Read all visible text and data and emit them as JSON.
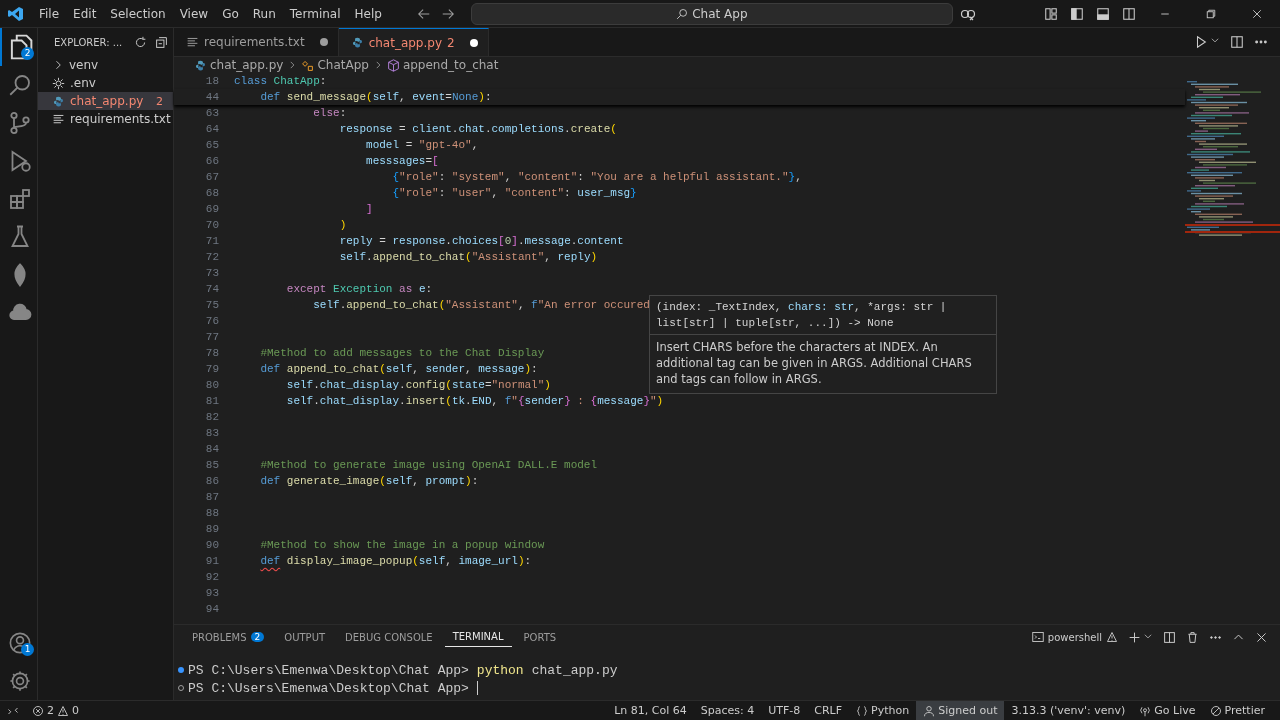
{
  "title_bar": {
    "menu": [
      "File",
      "Edit",
      "Selection",
      "View",
      "Go",
      "Run",
      "Terminal",
      "Help"
    ],
    "command_center": "Chat App"
  },
  "activity_bar": {
    "items": [
      {
        "kind": "files",
        "selected": true,
        "badge": "2"
      },
      {
        "kind": "search",
        "selected": false
      },
      {
        "kind": "branch",
        "selected": false
      },
      {
        "kind": "run",
        "selected": false
      },
      {
        "kind": "extensions",
        "selected": false
      },
      {
        "kind": "flask",
        "selected": false
      },
      {
        "kind": "leaf",
        "selected": false
      },
      {
        "kind": "cloud",
        "selected": false
      }
    ],
    "account_badge": "1"
  },
  "sidebar": {
    "title": "EXPLORER: ...",
    "items": [
      {
        "label": "venv",
        "kind": "folder",
        "expanded": false,
        "selected": false
      },
      {
        "label": ".env",
        "kind": "config",
        "selected": false
      },
      {
        "label": "chat_app.py",
        "kind": "python",
        "selected": true,
        "badge": "2"
      },
      {
        "label": "requirements.txt",
        "kind": "text",
        "selected": false
      }
    ]
  },
  "tabs": [
    {
      "label": "requirements.txt",
      "kind": "text",
      "selected": false,
      "modified": true
    },
    {
      "label": "chat_app.py",
      "kind": "python",
      "selected": true,
      "modified": true,
      "badge": "2"
    }
  ],
  "breadcrumbs": [
    {
      "label": "chat_app.py",
      "kind": "python"
    },
    {
      "label": "ChatApp",
      "kind": "class"
    },
    {
      "label": "append_to_chat",
      "kind": "method"
    }
  ],
  "editor": {
    "sticky_lines": [
      {
        "number": "18",
        "tokens": [
          {
            "text": "class ",
            "kind": "kwb"
          },
          {
            "text": "ChatApp",
            "kind": "cls"
          },
          {
            "text": ":",
            "kind": "p"
          }
        ]
      },
      {
        "number": "44",
        "tokens": [
          {
            "text": "    def ",
            "kind": "kwb"
          },
          {
            "text": "send_message",
            "kind": "fn"
          },
          {
            "text": "(",
            "kind": "b1"
          },
          {
            "text": "self",
            "kind": "var"
          },
          {
            "text": ", ",
            "kind": "p"
          },
          {
            "text": "event",
            "kind": "var"
          },
          {
            "text": "=",
            "kind": "p"
          },
          {
            "text": "None",
            "kind": "kwb"
          },
          {
            "text": ")",
            "kind": "b1"
          },
          {
            "text": ":",
            "kind": "p"
          }
        ]
      }
    ],
    "lines": [
      {
        "number": "63",
        "tokens": [
          {
            "text": "            else",
            "kind": "kw"
          },
          {
            "text": ":",
            "kind": "p"
          }
        ]
      },
      {
        "number": "64",
        "tokens": [
          {
            "text": "                response",
            "kind": "var"
          },
          {
            "text": " = ",
            "kind": "p"
          },
          {
            "text": "client",
            "kind": "var"
          },
          {
            "text": ".",
            "kind": "p"
          },
          {
            "text": "chat",
            "kind": "var"
          },
          {
            "text": ".",
            "kind": "p"
          },
          {
            "text": "completions",
            "kind": "var"
          },
          {
            "text": ".",
            "kind": "p"
          },
          {
            "text": "create",
            "kind": "fn"
          },
          {
            "text": "(",
            "kind": "b1"
          }
        ]
      },
      {
        "number": "65",
        "tokens": [
          {
            "text": "                    model",
            "kind": "var"
          },
          {
            "text": " = ",
            "kind": "p"
          },
          {
            "text": "\"gpt-4o\"",
            "kind": "str"
          },
          {
            "text": ",",
            "kind": "p"
          }
        ]
      },
      {
        "number": "66",
        "tokens": [
          {
            "text": "                    messsages",
            "kind": "var"
          },
          {
            "text": "=",
            "kind": "p"
          },
          {
            "text": "[",
            "kind": "b2"
          }
        ]
      },
      {
        "number": "67",
        "tokens": [
          {
            "text": "                        {",
            "kind": "b3"
          },
          {
            "text": "\"role\"",
            "kind": "str"
          },
          {
            "text": ": ",
            "kind": "p"
          },
          {
            "text": "\"system\"",
            "kind": "str"
          },
          {
            "text": ", ",
            "kind": "p"
          },
          {
            "text": "\"content\"",
            "kind": "str"
          },
          {
            "text": ": ",
            "kind": "p"
          },
          {
            "text": "\"You are a helpful assistant.\"",
            "kind": "str"
          },
          {
            "text": "}",
            "kind": "b3"
          },
          {
            "text": ",",
            "kind": "p"
          }
        ]
      },
      {
        "number": "68",
        "tokens": [
          {
            "text": "                        {",
            "kind": "b3"
          },
          {
            "text": "\"role\"",
            "kind": "str"
          },
          {
            "text": ": ",
            "kind": "p"
          },
          {
            "text": "\"user\"",
            "kind": "str"
          },
          {
            "text": ", ",
            "kind": "p"
          },
          {
            "text": "\"content\"",
            "kind": "str"
          },
          {
            "text": ": ",
            "kind": "p"
          },
          {
            "text": "user_msg",
            "kind": "var"
          },
          {
            "text": "}",
            "kind": "b3"
          }
        ]
      },
      {
        "number": "69",
        "tokens": [
          {
            "text": "                    ]",
            "kind": "b2"
          }
        ]
      },
      {
        "number": "70",
        "tokens": [
          {
            "text": "                )",
            "kind": "b1"
          }
        ]
      },
      {
        "number": "71",
        "tokens": [
          {
            "text": "                reply",
            "kind": "var"
          },
          {
            "text": " = ",
            "kind": "p"
          },
          {
            "text": "response",
            "kind": "var"
          },
          {
            "text": ".",
            "kind": "p"
          },
          {
            "text": "choices",
            "kind": "var"
          },
          {
            "text": "[",
            "kind": "b2"
          },
          {
            "text": "0",
            "kind": "num"
          },
          {
            "text": "]",
            "kind": "b2"
          },
          {
            "text": ".",
            "kind": "p"
          },
          {
            "text": "message",
            "kind": "var"
          },
          {
            "text": ".",
            "kind": "p"
          },
          {
            "text": "content",
            "kind": "var"
          }
        ]
      },
      {
        "number": "72",
        "tokens": [
          {
            "text": "                self",
            "kind": "var"
          },
          {
            "text": ".",
            "kind": "p"
          },
          {
            "text": "append_to_chat",
            "kind": "fn"
          },
          {
            "text": "(",
            "kind": "b1"
          },
          {
            "text": "\"Assistant\"",
            "kind": "str"
          },
          {
            "text": ", ",
            "kind": "p"
          },
          {
            "text": "reply",
            "kind": "var"
          },
          {
            "text": ")",
            "kind": "b1"
          }
        ]
      },
      {
        "number": "73"
      },
      {
        "number": "74",
        "tokens": [
          {
            "text": "        except ",
            "kind": "kw"
          },
          {
            "text": "Exception",
            "kind": "cls"
          },
          {
            "text": " as ",
            "kind": "kw"
          },
          {
            "text": "e",
            "kind": "var"
          },
          {
            "text": ":",
            "kind": "p"
          }
        ]
      },
      {
        "number": "75",
        "tokens": [
          {
            "text": "            self",
            "kind": "var"
          },
          {
            "text": ".",
            "kind": "p"
          },
          {
            "text": "append_to_chat",
            "kind": "fn"
          },
          {
            "text": "(",
            "kind": "b1"
          },
          {
            "text": "\"Assistant\"",
            "kind": "str"
          },
          {
            "text": ", ",
            "kind": "p"
          },
          {
            "text": "f",
            "kind": "kwb"
          },
          {
            "text": "\"An error occured",
            "kind": "str"
          }
        ]
      },
      {
        "number": "76"
      },
      {
        "number": "77"
      },
      {
        "number": "78",
        "tokens": [
          {
            "text": "    #Method to add messages to the Chat Display",
            "kind": "cmt"
          }
        ]
      },
      {
        "number": "79",
        "tokens": [
          {
            "text": "    def ",
            "kind": "kwb"
          },
          {
            "text": "append_to_chat",
            "kind": "fn"
          },
          {
            "text": "(",
            "kind": "b1"
          },
          {
            "text": "self",
            "kind": "var"
          },
          {
            "text": ", ",
            "kind": "p"
          },
          {
            "text": "sender",
            "kind": "var"
          },
          {
            "text": ", ",
            "kind": "p"
          },
          {
            "text": "message",
            "kind": "var"
          },
          {
            "text": ")",
            "kind": "b1"
          },
          {
            "text": ":",
            "kind": "p"
          }
        ]
      },
      {
        "number": "80",
        "tokens": [
          {
            "text": "        self",
            "kind": "var"
          },
          {
            "text": ".",
            "kind": "p"
          },
          {
            "text": "chat_display",
            "kind": "var"
          },
          {
            "text": ".",
            "kind": "p"
          },
          {
            "text": "config",
            "kind": "fn"
          },
          {
            "text": "(",
            "kind": "b1"
          },
          {
            "text": "state",
            "kind": "var"
          },
          {
            "text": "=",
            "kind": "p"
          },
          {
            "text": "\"normal\"",
            "kind": "str"
          },
          {
            "text": ")",
            "kind": "b1"
          }
        ]
      },
      {
        "number": "81",
        "tokens": [
          {
            "text": "        self",
            "kind": "var"
          },
          {
            "text": ".",
            "kind": "p"
          },
          {
            "text": "chat_display",
            "kind": "var"
          },
          {
            "text": ".",
            "kind": "p"
          },
          {
            "text": "insert",
            "kind": "fn"
          },
          {
            "text": "(",
            "kind": "b1"
          },
          {
            "text": "tk",
            "kind": "var"
          },
          {
            "text": ".",
            "kind": "p"
          },
          {
            "text": "END",
            "kind": "var"
          },
          {
            "text": ", ",
            "kind": "p"
          },
          {
            "text": "f",
            "kind": "kwb"
          },
          {
            "text": "\"",
            "kind": "str"
          },
          {
            "text": "{",
            "kind": "b2"
          },
          {
            "text": "sender",
            "kind": "var"
          },
          {
            "text": "}",
            "kind": "b2"
          },
          {
            "text": " : ",
            "kind": "str"
          },
          {
            "text": "{",
            "kind": "b2"
          },
          {
            "text": "message",
            "kind": "var"
          },
          {
            "text": "}",
            "kind": "b2"
          },
          {
            "text": "\"",
            "kind": "str"
          },
          {
            "text": ")",
            "kind": "b1"
          }
        ]
      },
      {
        "number": "82"
      },
      {
        "number": "83"
      },
      {
        "number": "84"
      },
      {
        "number": "85",
        "tokens": [
          {
            "text": "    #Method to generate image using OpenAI DALL.E model",
            "kind": "cmt"
          }
        ]
      },
      {
        "number": "86",
        "tokens": [
          {
            "text": "    def ",
            "kind": "kwb"
          },
          {
            "text": "generate_image",
            "kind": "fn"
          },
          {
            "text": "(",
            "kind": "b1"
          },
          {
            "text": "self",
            "kind": "var"
          },
          {
            "text": ", ",
            "kind": "p"
          },
          {
            "text": "prompt",
            "kind": "var"
          },
          {
            "text": ")",
            "kind": "b1"
          },
          {
            "text": ":",
            "kind": "p"
          }
        ]
      },
      {
        "number": "87"
      },
      {
        "number": "88"
      },
      {
        "number": "89"
      },
      {
        "number": "90",
        "tokens": [
          {
            "text": "    #Method to show the image in a popup window",
            "kind": "cmt"
          }
        ]
      },
      {
        "number": "91",
        "tokens": [
          {
            "text": "    def",
            "kind": "err"
          },
          {
            "text": " display_image_popup",
            "kind": "fn"
          },
          {
            "text": "(",
            "kind": "b1"
          },
          {
            "text": "self",
            "kind": "var"
          },
          {
            "text": ", ",
            "kind": "p"
          },
          {
            "text": "image_url",
            "kind": "var"
          },
          {
            "text": ")",
            "kind": "b1"
          },
          {
            "text": ":",
            "kind": "p"
          }
        ]
      },
      {
        "number": "92"
      },
      {
        "number": "93"
      },
      {
        "number": "94"
      }
    ]
  },
  "hover": {
    "signature": [
      {
        "text": "(index: _TextIndex, ",
        "kind": "p"
      },
      {
        "text": "chars: str",
        "kind": "var"
      },
      {
        "text": ", *args: str | list[str] | tuple[str, ...]) -> None",
        "kind": "p"
      }
    ],
    "doc": "Insert CHARS before the characters at INDEX. An additional tag can be given in ARGS. Additional CHARS and tags can follow in ARGS."
  },
  "panel": {
    "tabs": [
      {
        "label": "PROBLEMS",
        "selected": false,
        "badge": "2"
      },
      {
        "label": "OUTPUT",
        "selected": false
      },
      {
        "label": "DEBUG CONSOLE",
        "selected": false
      },
      {
        "label": "TERMINAL",
        "selected": true
      },
      {
        "label": "PORTS",
        "selected": false
      }
    ],
    "shell": "powershell",
    "terminal": [
      {
        "kind": "done",
        "prompt": "PS C:\\Users\\Emenwa\\Desktop\\Chat App>",
        "program": "python",
        "args": "chat_app.py"
      },
      {
        "kind": "idle",
        "prompt": "PS C:\\Users\\Emenwa\\Desktop\\Chat App>"
      }
    ]
  },
  "status_bar": {
    "errors": "2",
    "warnings": "0",
    "items": [
      {
        "text": "Ln 81, Col 64",
        "kind": "text",
        "hovered": false
      },
      {
        "text": "Spaces: 4",
        "kind": "text",
        "hovered": false
      },
      {
        "text": "UTF-8",
        "kind": "text",
        "hovered": false
      },
      {
        "text": "CRLF",
        "kind": "text",
        "hovered": false
      },
      {
        "text": "Python",
        "kind": "braces",
        "hovered": false
      },
      {
        "text": "Signed out",
        "kind": "account",
        "hovered": true
      },
      {
        "text": "3.13.3 ('venv': venv)",
        "kind": "text",
        "hovered": false
      },
      {
        "text": "Go Live",
        "kind": "broadcast",
        "hovered": false
      },
      {
        "text": "Prettier",
        "kind": "check",
        "hovered": false
      }
    ]
  }
}
